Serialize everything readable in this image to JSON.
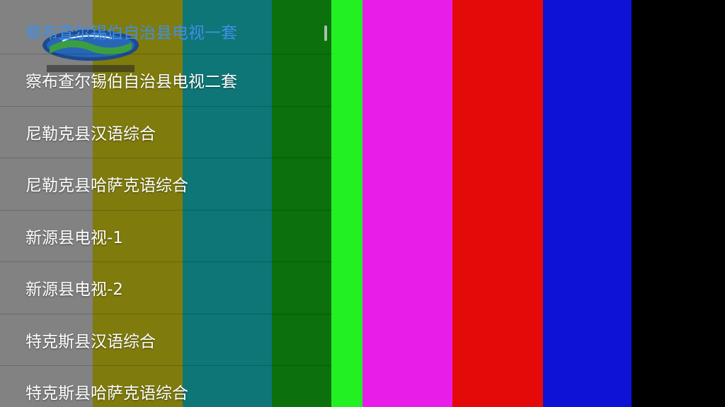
{
  "colors": {
    "bars": [
      "#8a8a8a",
      "#86820e",
      "#0f7d7d",
      "#0d760d",
      "#22f022",
      "#e81ee8",
      "#e40a0a",
      "#0d12d6"
    ],
    "selected_text": "#3f8fe6",
    "background": "#000000"
  },
  "logo": {
    "icon": "channel-logo-icon"
  },
  "channel_list": {
    "items": [
      {
        "label": "察布查尔锡伯自治县电视一套",
        "selected": true
      },
      {
        "label": "察布查尔锡伯自治县电视二套",
        "selected": false
      },
      {
        "label": "尼勒克县汉语综合",
        "selected": false
      },
      {
        "label": "尼勒克县哈萨克语综合",
        "selected": false
      },
      {
        "label": "新源县电视-1",
        "selected": false
      },
      {
        "label": "新源县电视-2",
        "selected": false
      },
      {
        "label": "特克斯县汉语综合",
        "selected": false
      },
      {
        "label": "特克斯县哈萨克语综合",
        "selected": false
      }
    ]
  }
}
